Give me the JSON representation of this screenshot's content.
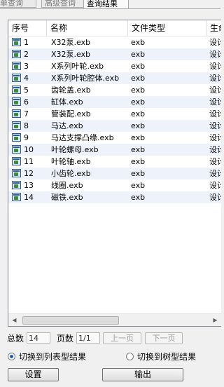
{
  "tabs": [
    {
      "label": "简单查询"
    },
    {
      "label": "高级查询"
    },
    {
      "label": "查询结果"
    }
  ],
  "list": {
    "columns": [
      "序号",
      "名称",
      "文件类型",
      "生命"
    ],
    "rows": [
      {
        "no": "1",
        "name": "X32泵.exb",
        "type": "exb",
        "life": "设计"
      },
      {
        "no": "2",
        "name": "X32泵.exb",
        "type": "exb",
        "life": "设计"
      },
      {
        "no": "3",
        "name": "X系列叶轮.exb",
        "type": "exb",
        "life": "设计"
      },
      {
        "no": "4",
        "name": "X系列叶轮腔体.exb",
        "type": "exb",
        "life": "设计"
      },
      {
        "no": "5",
        "name": "齿轮盖.exb",
        "type": "exb",
        "life": "设计"
      },
      {
        "no": "6",
        "name": "缸体.exb",
        "type": "exb",
        "life": "设计"
      },
      {
        "no": "7",
        "name": "管装配.exb",
        "type": "exb",
        "life": "设计"
      },
      {
        "no": "8",
        "name": "马达.exb",
        "type": "exb",
        "life": "设计"
      },
      {
        "no": "9",
        "name": "马达支撑凸缘.exb",
        "type": "exb",
        "life": "设计"
      },
      {
        "no": "10",
        "name": "叶轮螺母.exb",
        "type": "exb",
        "life": "设计"
      },
      {
        "no": "11",
        "name": "叶轮轴.exb",
        "type": "exb",
        "life": "设计"
      },
      {
        "no": "12",
        "name": "小齿轮.exb",
        "type": "exb",
        "life": "设计"
      },
      {
        "no": "13",
        "name": "线圈.exb",
        "type": "exb",
        "life": "设计"
      },
      {
        "no": "14",
        "name": "磁铁.exb",
        "type": "exb",
        "life": "设计"
      }
    ]
  },
  "pager": {
    "total_label": "总数",
    "total_value": "14",
    "page_label": "页数",
    "page_value": "1/1",
    "prev_label": "上一页",
    "next_label": "下一页"
  },
  "view_toggle": {
    "list_label": "切换到列表型结果",
    "tree_label": "切换到树型结果",
    "selected": "list"
  },
  "buttons": {
    "settings_label": "设置",
    "output_label": "输出"
  },
  "scrollbar": {
    "left_icon": "scroll-left-arrow",
    "right_icon": "scroll-right-arrow"
  }
}
